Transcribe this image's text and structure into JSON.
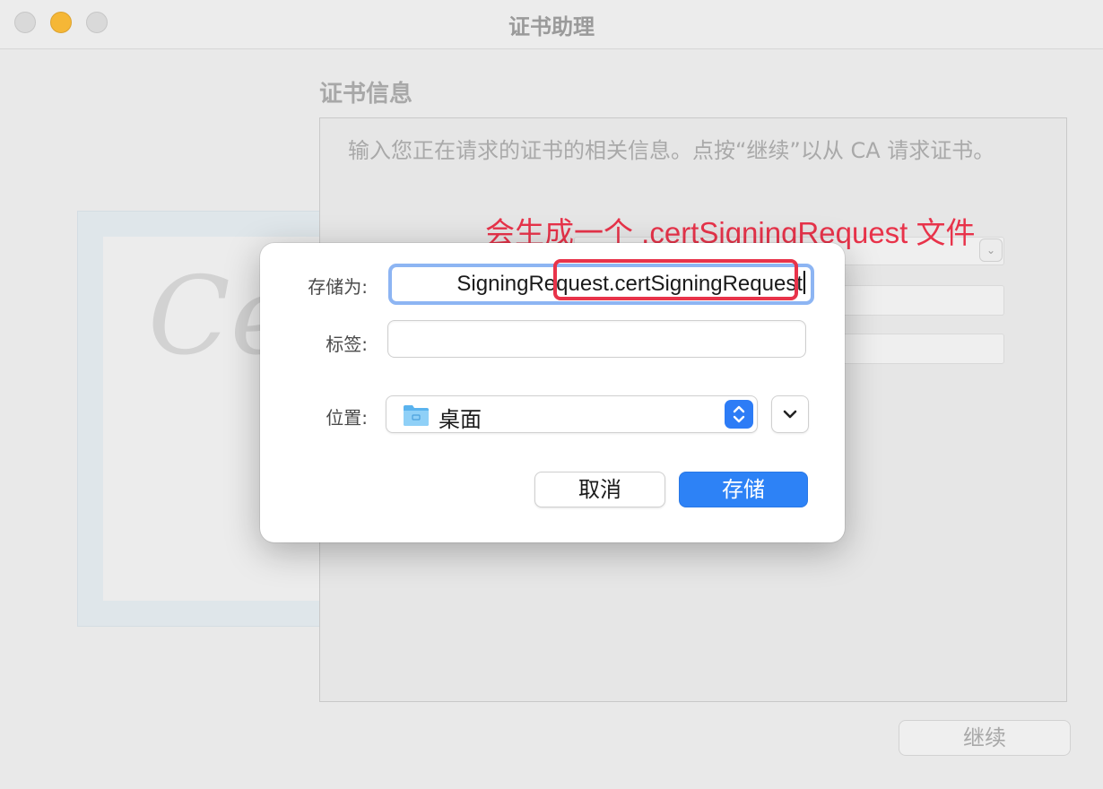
{
  "window": {
    "title": "证书助理"
  },
  "background": {
    "section_title": "证书信息",
    "info_text": "输入您正在请求的证书的相关信息。点按“继续”以从 CA 请求证书。",
    "continue_label": "继续"
  },
  "annotation": {
    "text": "会生成一个 .certSigningRequest 文件",
    "color": "#e8334a"
  },
  "dialog": {
    "save_as_label": "存储为:",
    "save_as_value": "SigningRequest.certSigningRequest",
    "tags_label": "标签:",
    "tags_value": "",
    "location_label": "位置:",
    "location_value": "桌面",
    "location_icon": "folder-icon",
    "cancel_label": "取消",
    "save_label": "存储",
    "accent_color": "#2d82f6"
  }
}
